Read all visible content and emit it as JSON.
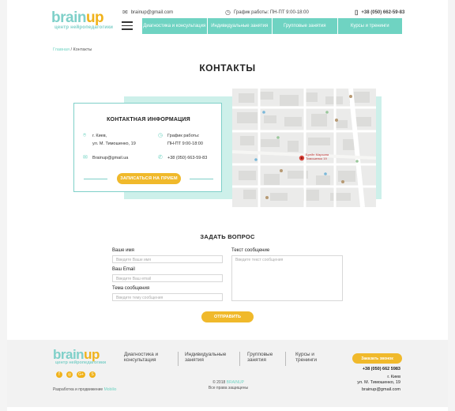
{
  "header": {
    "logo_part1": "brain",
    "logo_part2": "up",
    "logo_sub": "центр нейропедагогики",
    "email": "brainup@gmail.com",
    "schedule": "График работы: ПН-ПТ 9:00-18:00",
    "phone": "+38 (050) 662-59-83",
    "nav": [
      {
        "label": "Диагностика и консультация"
      },
      {
        "label": "Индивидуальные занятия"
      },
      {
        "label": "Групповые занятия"
      },
      {
        "label": "Курсы и тренинги"
      }
    ]
  },
  "breadcrumb": {
    "home": "Главная",
    "sep": " / ",
    "current": "Контакты"
  },
  "page_title": "КОНТАКТЫ",
  "contact_card": {
    "title": "КОНТАКТНАЯ ИНФОРМАЦИЯ",
    "address_line1": "г. Киев,",
    "address_line2": "ул. М. Тимошенко, 19",
    "hours_line1": "График работы:",
    "hours_line2": "ПН-ПТ 9:00-18:00",
    "email": "Brainup@gmail.ua",
    "phone": "+38 (050) 663-59-83",
    "button": "ЗАПИСАТЬСЯ НА ПРИЕМ"
  },
  "map": {
    "marker_label_1": "Брейн Марьяна",
    "marker_label_2": "Тимошенко 19"
  },
  "form": {
    "title": "ЗАДАТЬ ВОПРОС",
    "name_label": "Ваше имя",
    "name_placeholder": "Введите Ваше имя",
    "email_label": "Ваш Email",
    "email_placeholder": "Введите Ваш email",
    "subject_label": "Тема сообщения",
    "subject_placeholder": "Введите тему сообщения",
    "message_label": "Текст сообщение",
    "message_placeholder": "Введите текст сообщения",
    "submit": "ОТПРАВИТЬ"
  },
  "footer": {
    "nav": [
      {
        "label": "Диагностика и консультация"
      },
      {
        "label": "Индивидуальные занятия"
      },
      {
        "label": "Групповые занятия"
      },
      {
        "label": "Курсы и тренинги"
      }
    ],
    "cta": "Заказать звонок",
    "phone": "+38 (050) 662 5983",
    "city": "г. Киев",
    "street": "ул. М. Тимошенко, 19",
    "email": "brainup@gmail.com",
    "dev_text": "Разработка и продвижение",
    "dev_link": "Mobilio",
    "copyright_year": "© 2018",
    "copyright_brand": "BRAINUP",
    "rights": "Все права защищены",
    "social": [
      {
        "icon": "facebook-icon",
        "glyph": "f"
      },
      {
        "icon": "instagram-icon",
        "glyph": "◎"
      },
      {
        "icon": "google-plus-icon",
        "glyph": "G+"
      },
      {
        "icon": "skype-icon",
        "glyph": "S"
      }
    ]
  },
  "colors": {
    "teal": "#6fd3c2",
    "yellow": "#f0b92b",
    "light_teal": "#cdf0ea"
  }
}
